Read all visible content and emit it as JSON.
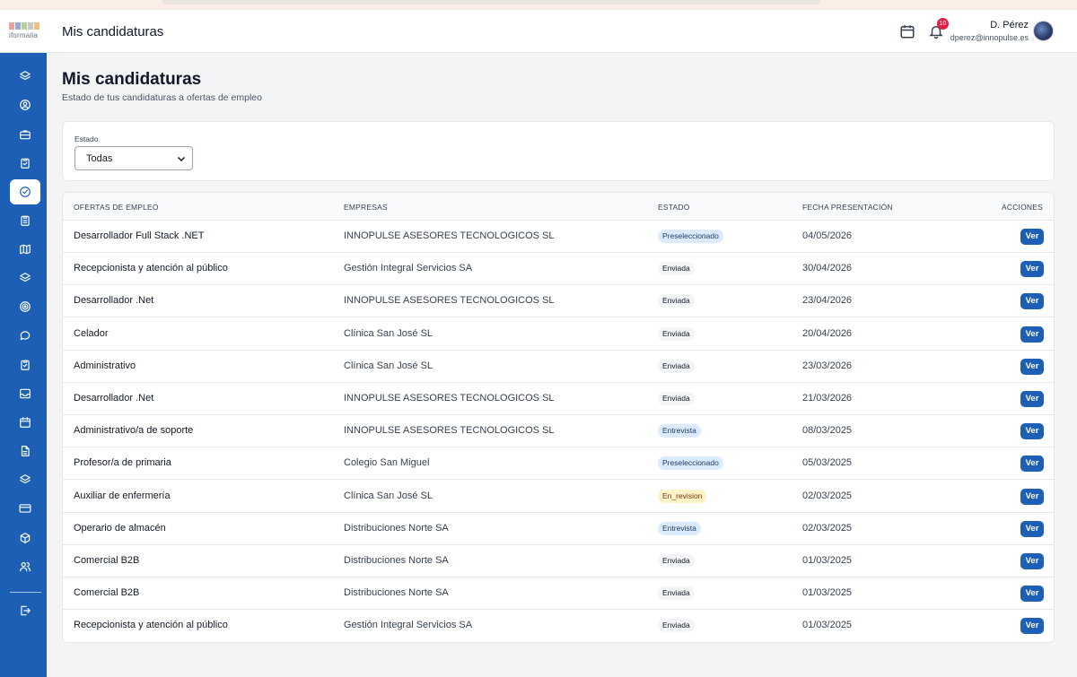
{
  "app": {
    "logo_text": "iformalia",
    "header_title": "Mis candidaturas",
    "notification_count": "10",
    "user_name": "D. Pérez",
    "user_email": "dperez@innopulse.es"
  },
  "page": {
    "title": "Mis candidaturas",
    "subtitle": "Estado de tus candidaturas a ofertas de empleo"
  },
  "filter": {
    "label": "Estado",
    "selected": "Todas"
  },
  "table": {
    "headers": {
      "offer": "OFERTAS DE EMPLEO",
      "company": "EMPRESAS",
      "status": "ESTADO",
      "date": "FECHA PRESENTACIÓN",
      "actions": "ACCIONES"
    },
    "action_label": "Ver",
    "rows": [
      {
        "offer": "Desarrollador Full Stack .NET",
        "company": "INNOPULSE ASESORES TECNOLOGICOS SL",
        "status": "Preseleccionado",
        "date": "04/05/2026"
      },
      {
        "offer": "Recepcionista y atención al público",
        "company": "Gestión Integral Servicios SA",
        "status": "Enviada",
        "date": "30/04/2026"
      },
      {
        "offer": "Desarrollador .Net",
        "company": "INNOPULSE ASESORES TECNOLOGICOS SL",
        "status": "Enviada",
        "date": "23/04/2026"
      },
      {
        "offer": "Celador",
        "company": "Clínica San José SL",
        "status": "Enviada",
        "date": "20/04/2026"
      },
      {
        "offer": "Administrativo",
        "company": "Clínica San José SL",
        "status": "Enviada",
        "date": "23/03/2026"
      },
      {
        "offer": "Desarrollador .Net",
        "company": "INNOPULSE ASESORES TECNOLOGICOS SL",
        "status": "Enviada",
        "date": "21/03/2026"
      },
      {
        "offer": "Administrativo/a de soporte",
        "company": "INNOPULSE ASESORES TECNOLOGICOS SL",
        "status": "Entrevista",
        "date": "08/03/2025"
      },
      {
        "offer": "Profesor/a de primaria",
        "company": "Colegio San Miguel",
        "status": "Preseleccionado",
        "date": "05/03/2025"
      },
      {
        "offer": "Auxiliar de enfermería",
        "company": "Clínica San José SL",
        "status": "En_revision",
        "date": "02/03/2025"
      },
      {
        "offer": "Operario de almacén",
        "company": "Distribuciones Norte SA",
        "status": "Entrevista",
        "date": "02/03/2025"
      },
      {
        "offer": "Comercial B2B",
        "company": "Distribuciones Norte SA",
        "status": "Enviada",
        "date": "01/03/2025"
      },
      {
        "offer": "Comercial B2B",
        "company": "Distribuciones Norte SA",
        "status": "Enviada",
        "date": "01/03/2025"
      },
      {
        "offer": "Recepcionista y atención al público",
        "company": "Gestión Integral Servicios SA",
        "status": "Enviada",
        "date": "01/03/2025"
      }
    ]
  },
  "sidebar": {
    "items": [
      {
        "icon": "layers-icon",
        "name": "sidebar-item-dashboard",
        "active": false
      },
      {
        "icon": "user-circle-icon",
        "name": "sidebar-item-profile",
        "active": false
      },
      {
        "icon": "briefcase-icon",
        "name": "sidebar-item-jobs",
        "active": false
      },
      {
        "icon": "clipboard-icon",
        "name": "sidebar-item-tasks",
        "active": false
      },
      {
        "icon": "check-circle-icon",
        "name": "sidebar-item-candidaturas",
        "active": true
      },
      {
        "icon": "clipboard-list-icon",
        "name": "sidebar-item-forms",
        "active": false
      },
      {
        "icon": "map-icon",
        "name": "sidebar-item-map",
        "active": false
      },
      {
        "icon": "layers-icon",
        "name": "sidebar-item-courses",
        "active": false
      },
      {
        "icon": "target-icon",
        "name": "sidebar-item-goals",
        "active": false
      },
      {
        "icon": "chat-icon",
        "name": "sidebar-item-messages",
        "active": false
      },
      {
        "icon": "clipboard-icon",
        "name": "sidebar-item-evaluations",
        "active": false
      },
      {
        "icon": "inbox-icon",
        "name": "sidebar-item-inbox",
        "active": false
      },
      {
        "icon": "calendar-icon",
        "name": "sidebar-item-calendar",
        "active": false
      },
      {
        "icon": "document-icon",
        "name": "sidebar-item-documents",
        "active": false
      },
      {
        "icon": "layers-icon",
        "name": "sidebar-item-resources",
        "active": false
      },
      {
        "icon": "credit-card-icon",
        "name": "sidebar-item-payments",
        "active": false
      },
      {
        "icon": "box-icon",
        "name": "sidebar-item-packages",
        "active": false
      },
      {
        "icon": "users-icon",
        "name": "sidebar-item-users",
        "active": false
      },
      {
        "icon": "logout-icon",
        "name": "sidebar-item-logout",
        "active": false
      }
    ]
  },
  "colors": {
    "sidebar": "#1d5fb4",
    "primary_button": "#1d5fb4",
    "badge": "#e11d48"
  }
}
